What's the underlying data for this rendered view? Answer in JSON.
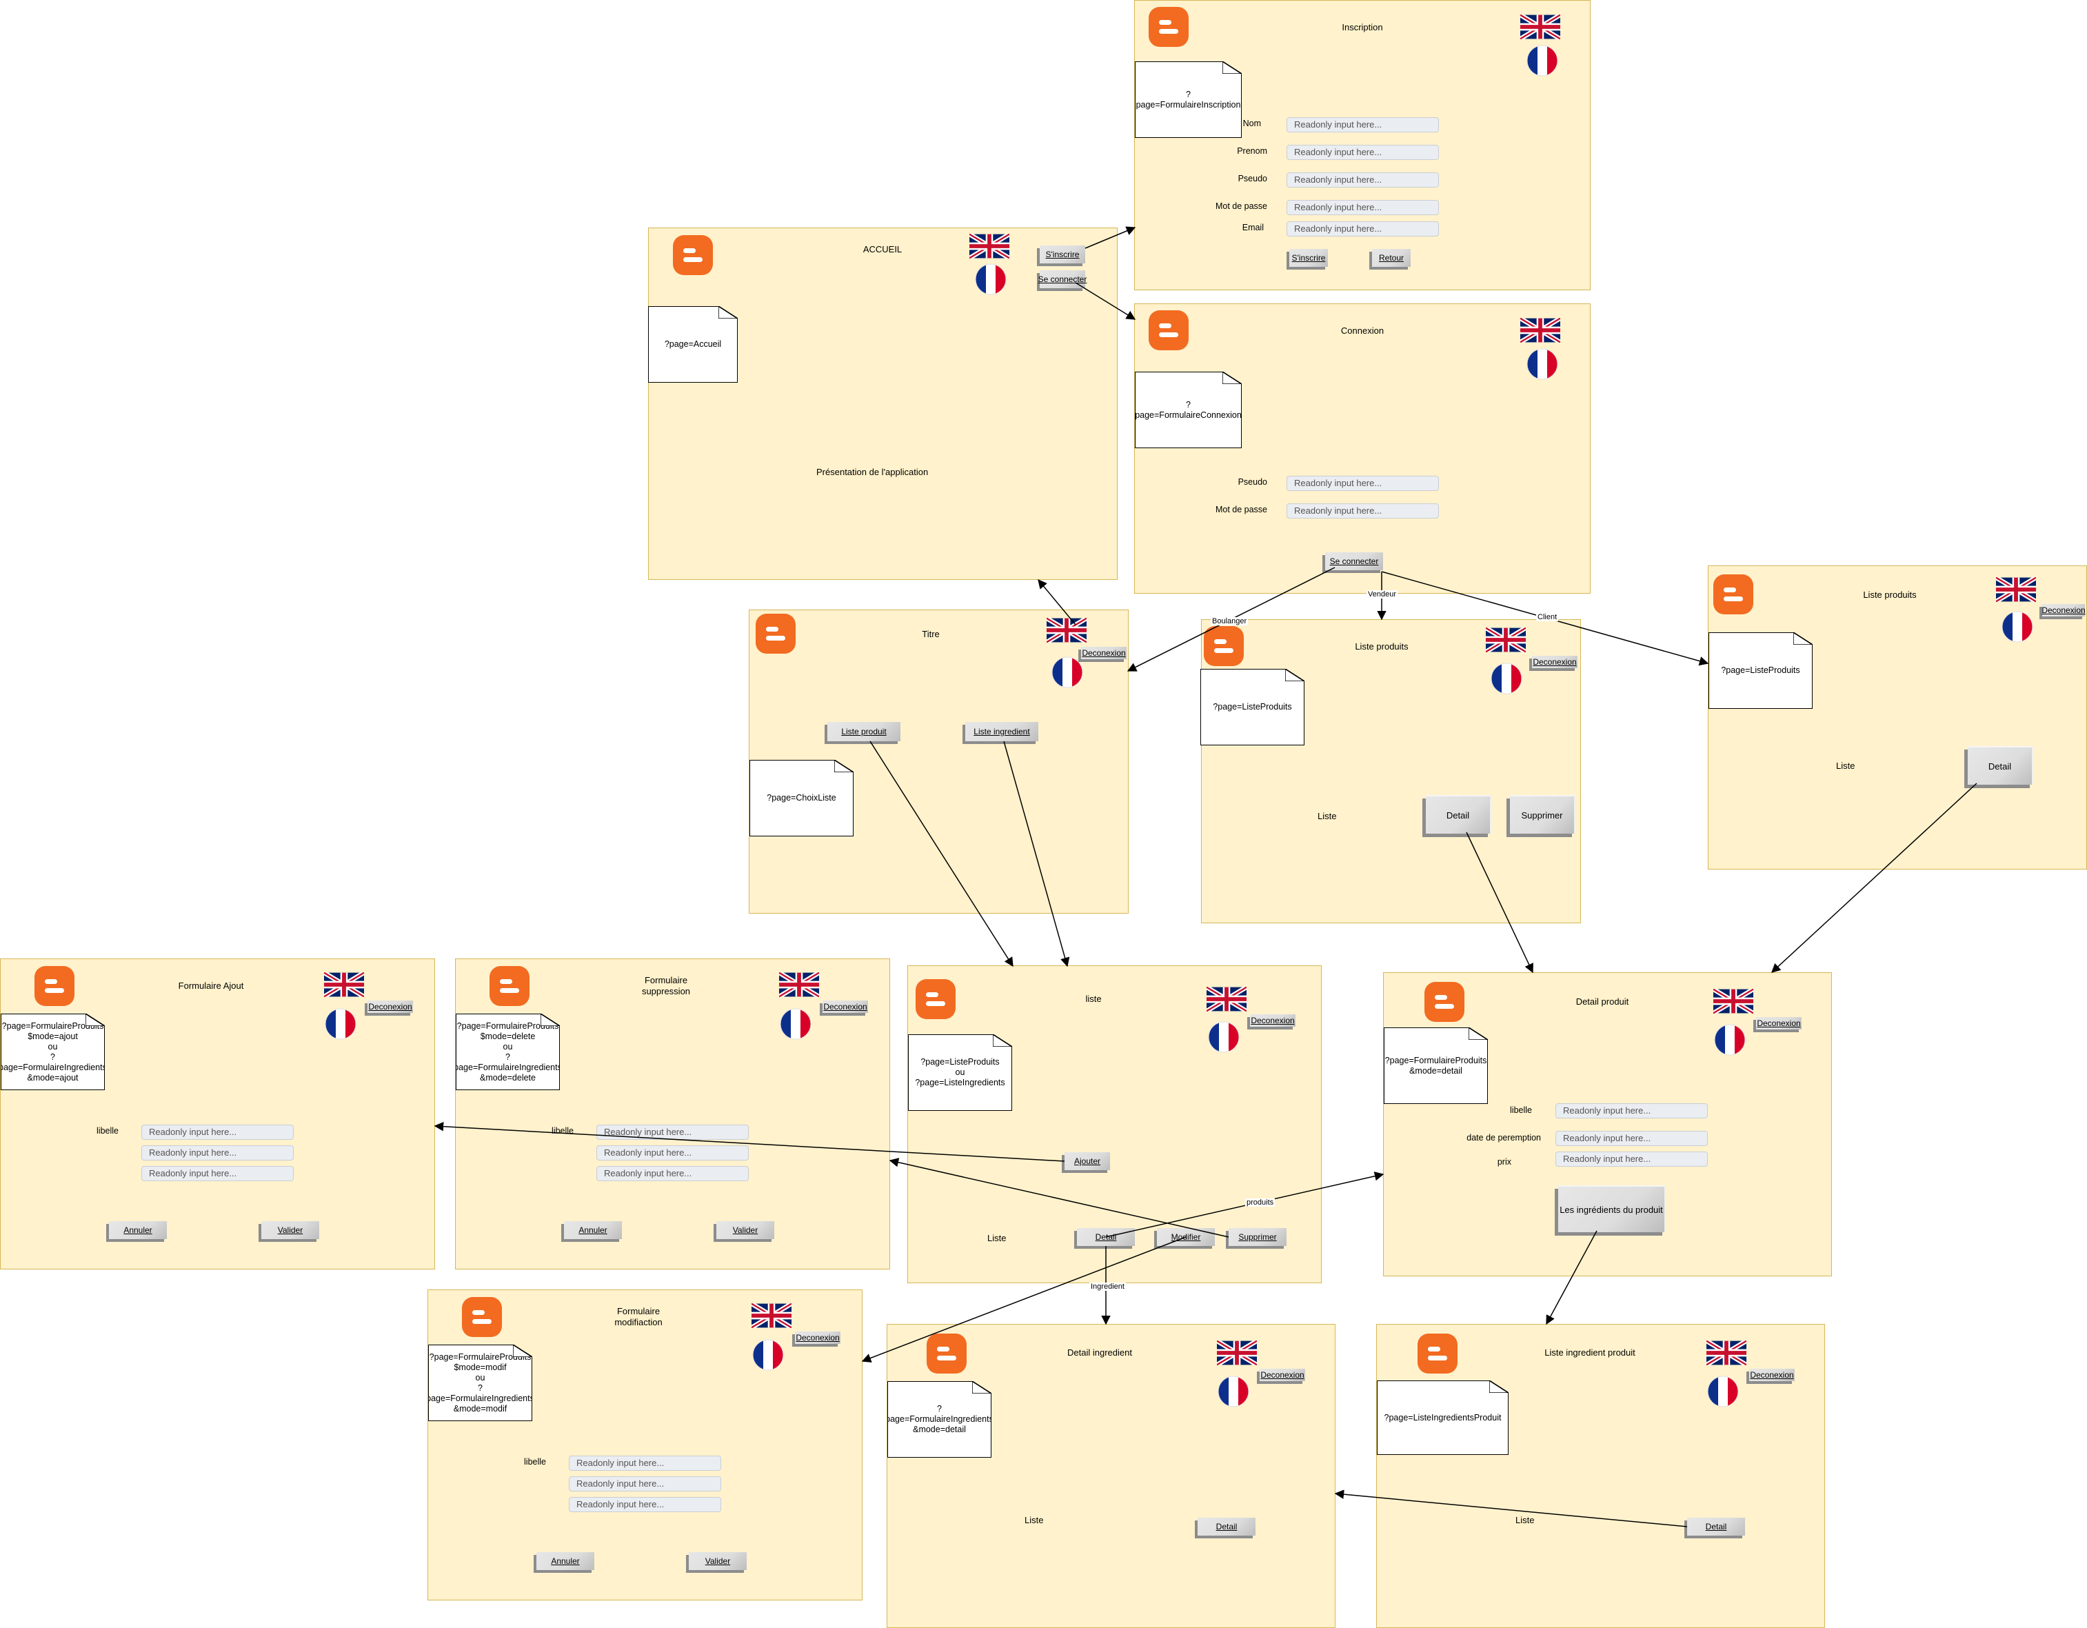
{
  "common": {
    "placeholder": "Readonly input here...",
    "colors": {
      "frame_fill": "#fff2cc",
      "frame_border": "#d6b656",
      "logo": "#f26b21"
    },
    "icons": [
      "blogger-logo-icon",
      "uk-flag-icon",
      "fr-flag-icon"
    ]
  },
  "screens": {
    "accueil": {
      "title": "ACCUEIL",
      "note": "?page=Accueil",
      "presentation": "Présentation de l'application",
      "btn_inscrire": "S'inscrire",
      "btn_connecter": "Se connecter"
    },
    "inscription": {
      "title": "Inscription",
      "note": "?page=FormulaireInscription",
      "labels": [
        "Nom",
        "Prenom",
        "Pseudo",
        "Mot de passe",
        "Email"
      ],
      "btn_inscrire": "S'inscrire",
      "btn_retour": "Retour"
    },
    "connexion": {
      "title": "Connexion",
      "note": "?page=FormulaireConnexion",
      "labels": [
        "Pseudo",
        "Mot de passe"
      ],
      "btn_connecter": "Se connecter"
    },
    "titre": {
      "title": "Titre",
      "note": "?page=ChoixListe",
      "btn_deco": "Deconexion",
      "btn_liste_produit": "Liste produit",
      "btn_liste_ingredient": "Liste ingredient"
    },
    "liste_produits_v": {
      "title": "Liste produits",
      "note": "?page=ListeProduits",
      "btn_deco": "Deconexion",
      "liste": "Liste",
      "btn_detail": "Detail",
      "btn_supprimer": "Supprimer"
    },
    "liste_produits_c": {
      "title": "Liste produits",
      "note": "?page=ListeProduits",
      "btn_deco": "Deconexion",
      "liste": "Liste",
      "btn_detail": "Detail"
    },
    "form_ajout": {
      "title": "Formulaire Ajout",
      "note": "?page=FormulaireProduits\n$mode=ajout\nou\n?page=FormulaireIngredients\n&mode=ajout",
      "btn_deco": "Deconexion",
      "label": "libelle",
      "btn_annuler": "Annuler",
      "btn_valider": "Valider"
    },
    "form_suppression": {
      "title": "Formulaire\nsuppression",
      "note": "?page=FormulaireProduits\n$mode=delete\nou\n?page=FormulaireIngredients\n&mode=delete",
      "btn_deco": "Deconexion",
      "label": "libelle",
      "btn_annuler": "Annuler",
      "btn_valider": "Valider"
    },
    "liste": {
      "title": "liste",
      "note": "?page=ListeProduits\nou\n?page=ListeIngredients",
      "btn_deco": "Deconexion",
      "liste": "Liste",
      "btn_ajouter": "Ajouter",
      "btn_detail": "Detail",
      "btn_modifier": "Modifier",
      "btn_supprimer": "Supprimer"
    },
    "detail_produit": {
      "title": "Detail produit",
      "note": "?page=FormulaireProduits\n&mode=detail",
      "btn_deco": "Deconexion",
      "labels": [
        "libelle",
        "date de peremption",
        "prix"
      ],
      "btn_ingredients": "Les ingrédients du produit"
    },
    "form_modification": {
      "title": "Formulaire\nmodifiaction",
      "note": "?page=FormulaireProduits\n$mode=modif\nou\n?page=FormulaireIngredients\n&mode=modif",
      "btn_deco": "Deconexion",
      "label": "libelle",
      "btn_annuler": "Annuler",
      "btn_valider": "Valider"
    },
    "detail_ingredient": {
      "title": "Detail ingredient",
      "note": "?page=FormulaireIngredients\n&mode=detail",
      "btn_deco": "Deconexion",
      "liste": "Liste",
      "btn_detail": "Detail"
    },
    "liste_ingredient_produit": {
      "title": "Liste ingredient produit",
      "note": "?page=ListeIngredientsProduit",
      "btn_deco": "Deconexion",
      "liste": "Liste",
      "btn_detail": "Detail"
    }
  },
  "edge_labels": {
    "boulanger": "Boulanger",
    "vendeur": "Vendeur",
    "client": "Client",
    "produits": "produits",
    "ingredient": "Ingredient"
  }
}
